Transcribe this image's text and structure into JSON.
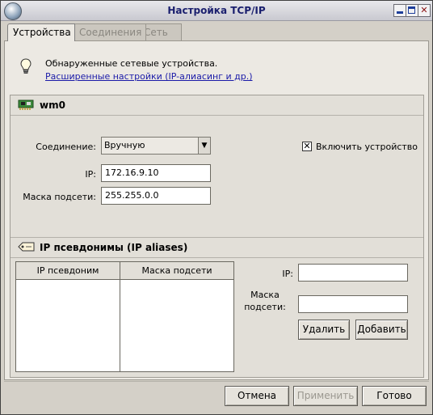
{
  "window": {
    "title": "Настройка TCP/IP"
  },
  "tabs": [
    {
      "label": "Устройства",
      "active": true
    },
    {
      "label": "Соединения",
      "active": false
    },
    {
      "label": "Сеть",
      "active": false
    }
  ],
  "info": {
    "text": "Обнаруженные сетевые устройства.",
    "link": "Расширенные настройки (IP-алиасинг и др.)"
  },
  "device": {
    "name": "wm0",
    "connection_label": "Соединение:",
    "connection_value": "Вручную",
    "enable_label": "Включить устройство",
    "enable_checked": true,
    "ip_label": "IP:",
    "ip_value": "172.16.9.10",
    "mask_label": "Маска подсети:",
    "mask_value": "255.255.0.0"
  },
  "aliases": {
    "title": "IP псевдонимы (IP aliases)",
    "columns": [
      "IP псевдоним",
      "Маска подсети"
    ],
    "ip_label": "IP:",
    "mask_label_1": "Маска",
    "mask_label_2": "подсети:",
    "ip_value": "",
    "mask_value": "",
    "remove_label": "Удалить",
    "add_label": "Добавить"
  },
  "footer": {
    "cancel_label": "Отмена",
    "apply_label": "Применить",
    "apply_enabled": false,
    "done_label": "Готово"
  }
}
